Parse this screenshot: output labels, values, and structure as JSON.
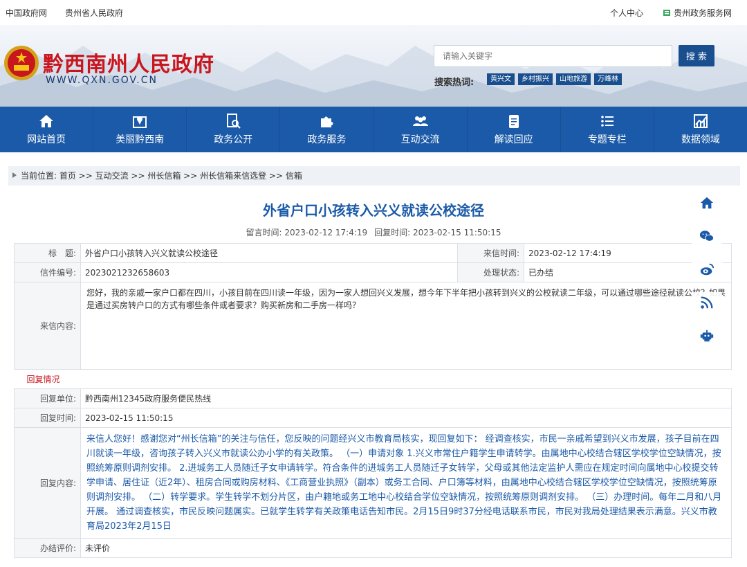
{
  "topbar": {
    "left_links": [
      "中国政府网",
      "贵州省人民政府"
    ],
    "personal_center": "个人中心",
    "service_net": "贵州政务服务网"
  },
  "header": {
    "site_title": "黔西南州人民政府",
    "site_url": "WWW.QXN.GOV.CN",
    "search_placeholder": "请输入关键字",
    "search_button": "搜 索",
    "hot_label": "搜索热词:",
    "hot_tags": [
      "黄兴文",
      "乡村振兴",
      "山地旅游",
      "万峰林"
    ]
  },
  "nav": {
    "items": [
      {
        "label": "网站首页",
        "icon": "home-icon"
      },
      {
        "label": "美丽黔西南",
        "icon": "map-pin-icon"
      },
      {
        "label": "政务公开",
        "icon": "document-search-icon"
      },
      {
        "label": "政务服务",
        "icon": "puzzle-icon"
      },
      {
        "label": "互动交流",
        "icon": "people-icon"
      },
      {
        "label": "解读回应",
        "icon": "clipboard-icon"
      },
      {
        "label": "专题专栏",
        "icon": "list-icon"
      },
      {
        "label": "数据领域",
        "icon": "chart-icon"
      }
    ]
  },
  "breadcrumb": "当前位置: 首页 >> 互动交流 >> 州长信箱 >> 州长信箱来信选登 >> 信箱",
  "article": {
    "title": "外省户口小孩转入兴义就读公校途径",
    "meta_left": "留言时间: 2023-02-12 17:4:19",
    "meta_right": "回复时间: 2023-02-15 11:50:15"
  },
  "table": {
    "title_label": "标　题:",
    "title_value": "外省户口小孩转入兴义就读公校途径",
    "date_label": "来信时间:",
    "date_value": "2023-02-12 17:4:19",
    "number_label": "信件编号:",
    "number_value": "2023021232658603",
    "status_label": "处理状态:",
    "status_value": "已办结",
    "content_label": "来信内容:",
    "content_value": "您好，我的亲戚一家户口都在四川，小孩目前在四川读一年级，因为一家人想回兴义发展，想今年下半年把小孩转到兴义的公校就读二年级，可以通过哪些途径就读公校？如果是通过买房转户口的方式有哪些条件或者要求？购买新房和二手房一样吗？",
    "reply_section": "回复情况",
    "reply_unit_label": "回复单位:",
    "reply_unit_value": "黔西南州12345政府服务便民热线",
    "reply_time_label": "回复时间:",
    "reply_time_value": "2023-02-15 11:50:15",
    "reply_content_label": "回复内容:",
    "reply_content_value": "来信人您好！感谢您对“州长信箱”的关注与信任，您反映的问题经兴义市教育局核实，现回复如下：  经调查核实，市民一亲戚希望到兴义市发展，孩子目前在四川就读一年级，咨询孩子转入兴义市就读公办小学的有关政策。  （一）申请对象 1.兴义市常住户籍学生申请转学。由属地中心校结合辖区学校学位空缺情况，按照统筹原则调剂安排。 2.进城务工人员随迁子女申请转学。符合条件的进城务工人员随迁子女转学，父母或其他法定监护人需应在规定时间向属地中心校提交转学申请、居住证（近2年）、租房合同或购房材料、《工商营业执照》（副本）或务工合同、户口簿等材料，由属地中心校结合辖区学校学位空缺情况，按照统筹原则调剂安排。 （二）转学要求。学生转学不划分片区，由户籍地或务工地中心校结合学位空缺情况，按照统筹原则调剂安排。 （三）办理时间。每年二月和八月开展。 通过调查核实，市民反映问题属实。已就学生转学有关政策电话告知市民。2月15日9时37分经电话联系市民，市民对我局处理结果表示满意。兴义市教育局2023年2月15日",
    "evaluation_label": "办结评价:",
    "evaluation_value": "未评价"
  },
  "float_icons": [
    "home-icon",
    "wechat-icon",
    "weibo-icon",
    "rss-icon",
    "robot-icon"
  ],
  "colors": {
    "nav_blue": "#1b5aa8",
    "title_red": "#c9151e",
    "reply_blue": "#1b5aa8"
  }
}
